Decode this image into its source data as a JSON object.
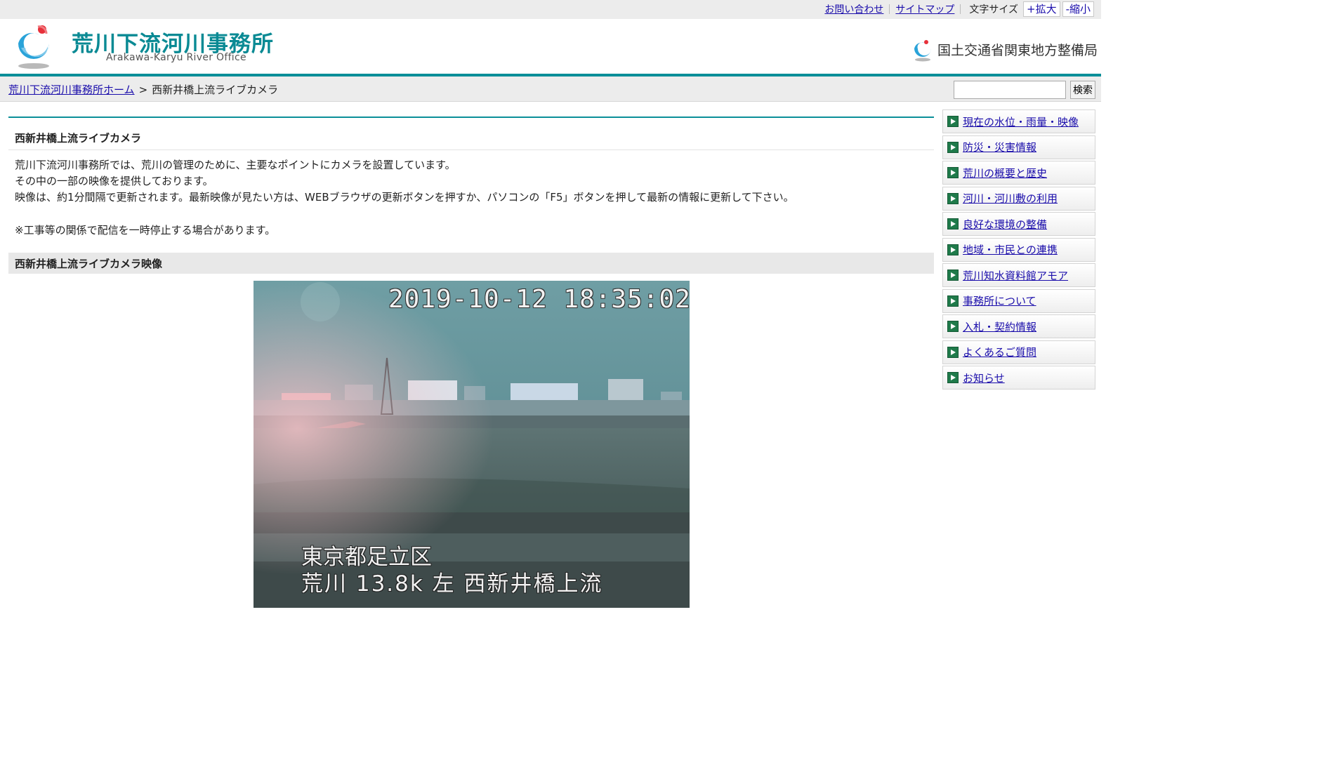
{
  "utility": {
    "contact": "お問い合わせ",
    "sitemap": "サイトマップ",
    "font_size_label": "文字サイズ",
    "enlarge": "+拡大",
    "shrink": "-縮小"
  },
  "header": {
    "title": "荒川下流河川事務所",
    "subtitle": "Arakawa-Karyu River Office",
    "ministry": "国土交通省関東地方整備局"
  },
  "breadcrumb": {
    "home": "荒川下流河川事務所ホーム",
    "separator": ">",
    "current": "西新井橋上流ライブカメラ"
  },
  "search": {
    "value": "",
    "button": "検索"
  },
  "main": {
    "title": "西新井橋上流ライブカメラ",
    "intro_lines": [
      "荒川下流河川事務所では、荒川の管理のために、主要なポイントにカメラを設置しています。",
      "その中の一部の映像を提供しております。",
      "映像は、約1分間隔で更新されます。最新映像が見たい方は、WEBブラウザの更新ボタンを押すか、パソコンの「F5」ボタンを押して最新の情報に更新して下さい。"
    ],
    "note": "※工事等の関係で配信を一時停止する場合があります。",
    "video_heading": "西新井橋上流ライブカメラ映像"
  },
  "camera": {
    "timestamp": "2019-10-12 18:35:02",
    "location": "東京都足立区",
    "point": "荒川 13.8k 左 西新井橋上流"
  },
  "sidebar": {
    "items": [
      "現在の水位・雨量・映像",
      "防災・災害情報",
      "荒川の概要と歴史",
      "河川・河川敷の利用",
      "良好な環境の整備",
      "地域・市民との連携",
      "荒川知水資料館アモア",
      "事務所について",
      "入札・契約情報",
      "よくあるご質問",
      "お知らせ"
    ]
  },
  "colors": {
    "brand_teal": "#0b8f99",
    "link": "#1a0dab",
    "nav_arrow": "#1f7a4a"
  }
}
